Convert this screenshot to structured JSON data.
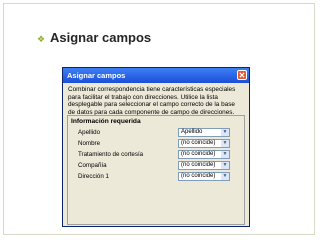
{
  "slide": {
    "bullet_glyph": "❖",
    "title": "Asignar campos"
  },
  "dialog": {
    "title": "Asignar campos",
    "close_glyph": "✕",
    "description": "Combinar correspondencia tiene características especiales para facilitar el trabajo con direcciones. Utilice la lista desplegable para seleccionar el campo correcto de la base de datos para cada componente de campo de direcciones.",
    "group_title": "Información requerida",
    "fields": [
      {
        "label": "Apellido",
        "value": "Apellido"
      },
      {
        "label": "Nombre",
        "value": "(no coincide)"
      },
      {
        "label": "Tratamiento de cortesía",
        "value": "(no coincide)"
      },
      {
        "label": "Compañía",
        "value": "(no coincide)"
      },
      {
        "label": "Dirección 1",
        "value": "(no coincide)"
      }
    ],
    "arrow_glyph": "▼"
  }
}
